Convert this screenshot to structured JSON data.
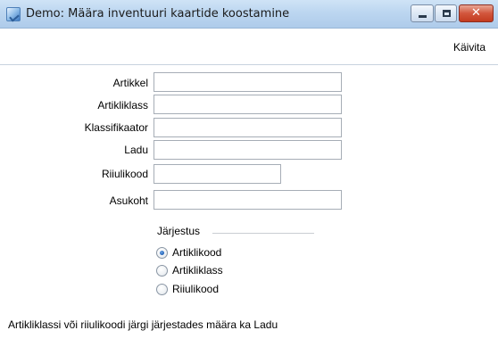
{
  "window": {
    "title": "Demo: Määra inventuuri kaartide koostamine",
    "close_glyph": "✕"
  },
  "menubar": {
    "run_label": "Käivita"
  },
  "form": {
    "fields": [
      {
        "label": "Artikkel",
        "value": ""
      },
      {
        "label": "Artikliklass",
        "value": ""
      },
      {
        "label": "Klassifikaator",
        "value": ""
      },
      {
        "label": "Ladu",
        "value": ""
      },
      {
        "label": "Riiulikood",
        "value": ""
      },
      {
        "label": "Asukoht",
        "value": ""
      }
    ]
  },
  "sort": {
    "title": "Järjestus",
    "options": [
      {
        "label": "Artiklikood",
        "selected": true
      },
      {
        "label": "Artikliklass",
        "selected": false
      },
      {
        "label": "Riiulikood",
        "selected": false
      }
    ]
  },
  "footer": {
    "note": "Artikliklassi või riiulikoodi järgi järjestades määra ka Ladu"
  },
  "icons": {
    "app": "app-icon",
    "minimize": "minimize-icon",
    "maximize": "maximize-icon",
    "close": "close-icon"
  }
}
